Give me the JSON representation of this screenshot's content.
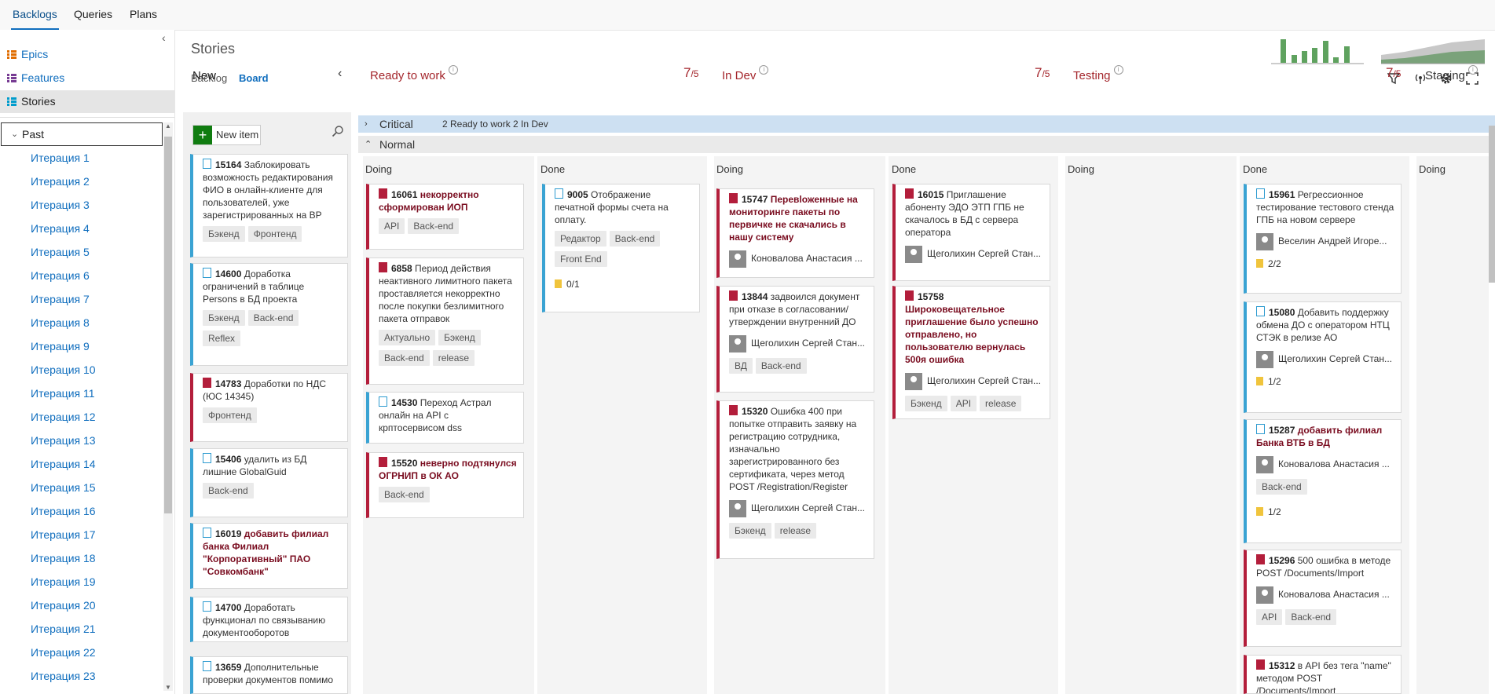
{
  "top_tabs": [
    "Backlogs",
    "Queries",
    "Plans"
  ],
  "levels": [
    {
      "label": "Epics",
      "color": "#e06c00"
    },
    {
      "label": "Features",
      "color": "#773b93"
    },
    {
      "label": "Stories",
      "color": "#009ccc"
    }
  ],
  "tree": {
    "root": "Past",
    "iterations": [
      "Итерация 1",
      "Итерация 2",
      "Итерация 3",
      "Итерация 4",
      "Итерация 5",
      "Итерация 6",
      "Итерация 7",
      "Итерация 8",
      "Итерация 9",
      "Итерация 10",
      "Итерация 11",
      "Итерация 12",
      "Итерация 13",
      "Итерация 14",
      "Итерация 15",
      "Итерация 16",
      "Итерация 17",
      "Итерация 18",
      "Итерация 19",
      "Итерация 20",
      "Итерация 21",
      "Итерация 22",
      "Итерация 23"
    ]
  },
  "page": {
    "title": "Stories",
    "subtabs": [
      "Backlog",
      "Board"
    ]
  },
  "columns": {
    "new": "New",
    "ready": {
      "name": "Ready to work",
      "wip_current": "7",
      "wip_limit": "/5"
    },
    "indev": {
      "name": "In Dev",
      "wip_current": "7",
      "wip_limit": "/5"
    },
    "testing": {
      "name": "Testing",
      "wip_current": "7",
      "wip_limit": "/5"
    },
    "staging": {
      "name": "Staging"
    }
  },
  "subcolumns": {
    "doing": "Doing",
    "done": "Done"
  },
  "swimlanes": {
    "critical": {
      "name": "Critical",
      "counts": "2  Ready to work   2  In Dev"
    },
    "normal": {
      "name": "Normal"
    }
  },
  "new_item_label": "New item",
  "new_cards": [
    {
      "id": "15164",
      "title": "Заблокировать возможность редактирования ФИО в онлайн-клиенте для пользователей, уже зарегистрированных на ВР",
      "tags": [
        "Бэкенд",
        "Фронтенд"
      ],
      "bug": false,
      "bold": false
    },
    {
      "id": "14600",
      "title": "Доработка ограничений в таблице Persons в БД проекта",
      "tags": [
        "Бэкенд",
        "Back-end",
        "Reflex"
      ],
      "bug": false,
      "bold": false
    },
    {
      "id": "14783",
      "title": "Доработки по НДС (ЮС 14345)",
      "tags": [
        "Фронтенд"
      ],
      "bug": true,
      "bold": false
    },
    {
      "id": "15406",
      "title": "удалить из БД лишние GlobalGuid",
      "tags": [
        "Back-end"
      ],
      "bug": false,
      "bold": false
    },
    {
      "id": "16019",
      "title": "добавить филиал банка Филиал \"Корпоративный\" ПАО \"Совкомбанк\"",
      "tags": [],
      "bug": false,
      "bold": true
    },
    {
      "id": "14700",
      "title": "Доработать функционал по связыванию документооборотов",
      "tags": [],
      "bug": false,
      "bold": false
    },
    {
      "id": "13659",
      "title": "Дополнительные проверки документов помимо",
      "tags": [],
      "bug": false,
      "bold": false
    }
  ],
  "ready_doing_cards": [
    {
      "id": "16061",
      "title": "некорректно сформирован ИОП",
      "tags": [
        "API",
        "Back-end"
      ],
      "bug": true,
      "bold": true
    },
    {
      "id": "6858",
      "title": "Период действия неактивного лимитного пакета проставляется некорректно после покупки безлимитного пакета отправок",
      "tags": [
        "Актуально",
        "Бэкенд",
        "Back-end",
        "release"
      ],
      "bug": true,
      "bold": false
    },
    {
      "id": "14530",
      "title": "Переход Астрал онлайн на API  с крптосервисом dss",
      "tags": [],
      "bug": false,
      "bold": false
    },
    {
      "id": "15520",
      "title": "неверно подтянулся ОГРНИП в ОК АО",
      "tags": [
        "Back-end"
      ],
      "bug": true,
      "bold": true
    }
  ],
  "ready_done_cards": [
    {
      "id": "9005",
      "title": "Отображение печатной формы счета на оплату.",
      "tags": [
        "Редактор",
        "Back-end",
        "Front End"
      ],
      "checklist": "0/1",
      "bug": false,
      "bold": false
    }
  ],
  "indev_doing_cards": [
    {
      "id": "15747",
      "title": "Перевloженные на мониторинге пакеты по первичке не скачались в нашу систему",
      "person": "Коновалова Анастасия ...",
      "tags": [],
      "bug": true,
      "bold": true
    },
    {
      "id": "13844",
      "title": "задвоился документ при отказе в согласовании/утверждении внутренний ДО",
      "person": "Щеголихин Сергей Стан...",
      "tags": [
        "ВД",
        "Back-end"
      ],
      "bug": true,
      "bold": false
    },
    {
      "id": "15320",
      "title": "Ошибка 400 при попытке отправить заявку на регистрацию сотрудника, изначально зарегистрированного без сертификата, через метод POST /Registration/Register",
      "person": "Щеголихин Сергей Стан...",
      "tags": [
        "Бэкенд",
        "release"
      ],
      "bug": true,
      "bold": false
    }
  ],
  "indev_done_cards": [
    {
      "id": "16015",
      "title": "Приглашение абоненту ЭДО ЭТП ГПБ не скачалось в БД с сервера оператора",
      "person": "Щеголихин Сергей Стан...",
      "tags": [],
      "bug": true,
      "bold": false
    },
    {
      "id": "15758",
      "title": "Широковещательное приглашение было успешно отправлено, но пользователю вернулась 500я ошибка",
      "person": "Щеголихин Сергей Стан...",
      "tags": [
        "Бэкенд",
        "API",
        "release"
      ],
      "bug": true,
      "bold": true
    }
  ],
  "testing_done_cards": [
    {
      "id": "15961",
      "title": "Регрессионное тестирование тестового стенда ГПБ на новом сервере",
      "person": "Веселин Андрей Игоре...",
      "checklist": "2/2",
      "tags": [],
      "bug": false,
      "bold": false
    },
    {
      "id": "15080",
      "title": "Добавить поддержку обмена ДО с оператором НТЦ СТЭК в релизе АО",
      "person": "Щеголихин Сергей Стан...",
      "checklist": "1/2",
      "tags": [],
      "bug": false,
      "bold": false
    },
    {
      "id": "15287",
      "title": "добавить филиал Банка ВТБ в БД",
      "person": "Коновалова Анастасия ...",
      "checklist": "1/2",
      "tags": [
        "Back-end"
      ],
      "bug": false,
      "bold": true
    },
    {
      "id": "15296",
      "title": "500 ошибка в методе POST /Documents/Import",
      "person": "Коновалова Анастасия ...",
      "tags": [
        "API",
        "Back-end"
      ],
      "bug": true,
      "bold": false
    },
    {
      "id": "15312",
      "title": "в API без тега \"name\" методом POST /Documents/Import",
      "tags": [],
      "bug": true,
      "bold": false
    }
  ],
  "colors": {
    "accent": "#106ebe",
    "bug": "#b31e3b",
    "story": "#3aa3d3",
    "critical_lane": "#cde0f2",
    "wip": "#a4262c"
  }
}
